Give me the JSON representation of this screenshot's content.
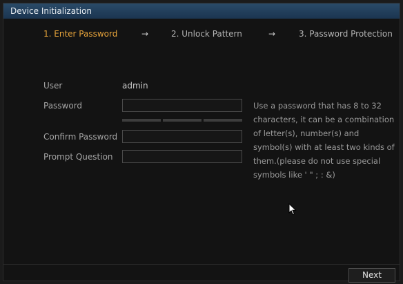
{
  "window": {
    "title": "Device Initialization"
  },
  "steps": [
    {
      "label": "1.  Enter Password",
      "active": true
    },
    {
      "label": "2.  Unlock Pattern",
      "active": false
    },
    {
      "label": "3.  Password Protection",
      "active": false
    }
  ],
  "step_arrow": "→",
  "form": {
    "user_label": "User",
    "user_value": "admin",
    "password_label": "Password",
    "password_value": "",
    "confirm_label": "Confirm Password",
    "confirm_value": "",
    "prompt_label": "Prompt Question",
    "prompt_value": ""
  },
  "hint": "Use a password that has 8 to 32 characters, it can be a combination of letter(s), number(s) and symbol(s) with at least two kinds of them.(please do not use special symbols like ' \" ; : &)",
  "footer": {
    "next_label": "Next"
  },
  "colors": {
    "titlebar": "#1f3a55",
    "active_step": "#e6a33a"
  }
}
